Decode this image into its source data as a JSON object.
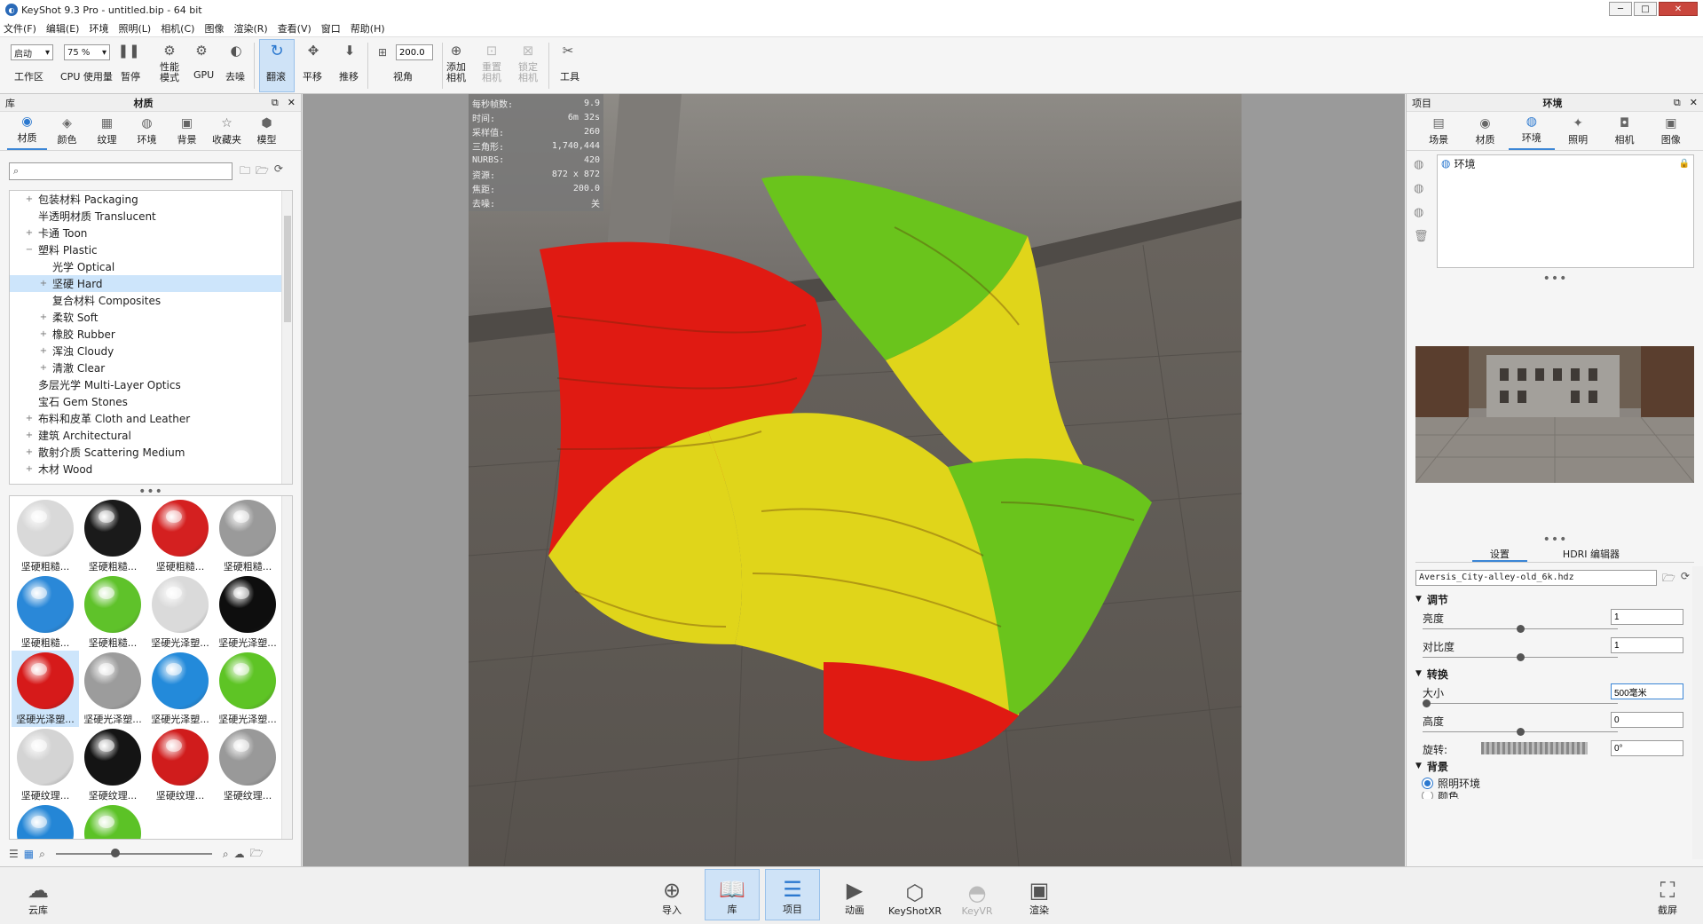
{
  "window": {
    "title": "KeyShot 9.3 Pro  - untitled.bip  - 64 bit",
    "minimize": "─",
    "maximize": "□",
    "close": "✕"
  },
  "menu": [
    "文件(F)",
    "编辑(E)",
    "环境",
    "照明(L)",
    "相机(C)",
    "图像",
    "渲染(R)",
    "查看(V)",
    "窗口",
    "帮助(H)"
  ],
  "toolbar": {
    "workspace_select": "启动",
    "workspace_label": "工作区",
    "cpu_select": "75 %",
    "cpu_label": "CPU 使用量",
    "pause_label": "暂停",
    "perf_label_1": "性能",
    "perf_label_2": "模式",
    "gpu_label": "GPU",
    "denoise_label": "去噪",
    "tumble_label": "翻滚",
    "pan_label": "平移",
    "dolly_label": "推移",
    "fov_value": "200.0",
    "fov_label": "视角",
    "add_camera_1": "添加",
    "add_camera_2": "相机",
    "reset_camera_1": "重置",
    "reset_camera_2": "相机",
    "lock_camera_1": "锁定",
    "lock_camera_2": "相机",
    "tools_label": "工具"
  },
  "library": {
    "header_left": "库",
    "header_title": "材质",
    "tabs": [
      {
        "label": "材质",
        "icon": "material-icon",
        "glyph": "◉"
      },
      {
        "label": "颜色",
        "icon": "color-icon",
        "glyph": "◈"
      },
      {
        "label": "纹理",
        "icon": "texture-icon",
        "glyph": "▦"
      },
      {
        "label": "环境",
        "icon": "environment-icon",
        "glyph": "◍"
      },
      {
        "label": "背景",
        "icon": "background-icon",
        "glyph": "▣"
      },
      {
        "label": "收藏夹",
        "icon": "favorites-icon",
        "glyph": "☆"
      },
      {
        "label": "模型",
        "icon": "model-icon",
        "glyph": "⬢"
      }
    ],
    "search_placeholder": "",
    "tree": [
      {
        "label": "包装材料 Packaging",
        "level": 1,
        "toggle": "+",
        "selected": false
      },
      {
        "label": "半透明材质 Translucent",
        "level": 1,
        "toggle": "",
        "selected": false
      },
      {
        "label": "卡通 Toon",
        "level": 1,
        "toggle": "+",
        "selected": false
      },
      {
        "label": "塑料 Plastic",
        "level": 1,
        "toggle": "−",
        "selected": false
      },
      {
        "label": "光学 Optical",
        "level": 2,
        "toggle": "",
        "selected": false
      },
      {
        "label": "坚硬 Hard",
        "level": 2,
        "toggle": "+",
        "selected": true
      },
      {
        "label": "复合材料 Composites",
        "level": 2,
        "toggle": "",
        "selected": false
      },
      {
        "label": "柔软 Soft",
        "level": 2,
        "toggle": "+",
        "selected": false
      },
      {
        "label": "橡胶 Rubber",
        "level": 2,
        "toggle": "+",
        "selected": false
      },
      {
        "label": "浑浊 Cloudy",
        "level": 2,
        "toggle": "+",
        "selected": false
      },
      {
        "label": "清澈 Clear",
        "level": 2,
        "toggle": "+",
        "selected": false
      },
      {
        "label": "多层光学 Multi-Layer Optics",
        "level": 1,
        "toggle": "",
        "selected": false
      },
      {
        "label": "宝石 Gem Stones",
        "level": 1,
        "toggle": "",
        "selected": false
      },
      {
        "label": "布料和皮革 Cloth and Leather",
        "level": 1,
        "toggle": "+",
        "selected": false
      },
      {
        "label": "建筑 Architectural",
        "level": 1,
        "toggle": "+",
        "selected": false
      },
      {
        "label": "散射介质 Scattering Medium",
        "level": 1,
        "toggle": "+",
        "selected": false
      },
      {
        "label": "木材 Wood",
        "level": 1,
        "toggle": "+",
        "selected": false
      }
    ],
    "thumbnails": [
      {
        "label": "坚硬粗糙...",
        "color": "#d9d9d9",
        "selected": false
      },
      {
        "label": "坚硬粗糙...",
        "color": "#1a1a1a",
        "selected": false
      },
      {
        "label": "坚硬粗糙...",
        "color": "#d42020",
        "selected": false
      },
      {
        "label": "坚硬粗糙...",
        "color": "#9a9a9a",
        "selected": false
      },
      {
        "label": "坚硬粗糙...",
        "color": "#2a88d8",
        "selected": false
      },
      {
        "label": "坚硬粗糙...",
        "color": "#5fc22a",
        "selected": false
      },
      {
        "label": "坚硬光泽塑...",
        "color": "#dadada",
        "selected": false
      },
      {
        "label": "坚硬光泽塑...",
        "color": "#0e0e0e",
        "selected": false
      },
      {
        "label": "坚硬光泽塑...",
        "color": "#d61a1a",
        "selected": true
      },
      {
        "label": "坚硬光泽塑...",
        "color": "#9c9c9c",
        "selected": false
      },
      {
        "label": "坚硬光泽塑...",
        "color": "#238ada",
        "selected": false
      },
      {
        "label": "坚硬光泽塑...",
        "color": "#5ec425",
        "selected": false
      },
      {
        "label": "坚硬纹理...",
        "color": "#d4d4d4",
        "selected": false
      },
      {
        "label": "坚硬纹理...",
        "color": "#141414",
        "selected": false
      },
      {
        "label": "坚硬纹理...",
        "color": "#d01c1c",
        "selected": false
      },
      {
        "label": "坚硬纹理...",
        "color": "#999999",
        "selected": false
      },
      {
        "label": "",
        "color": "#2486d6",
        "selected": false
      },
      {
        "label": "",
        "color": "#5cc226",
        "selected": false
      }
    ]
  },
  "stats": [
    {
      "label": "每秒帧数:",
      "value": "9.9"
    },
    {
      "label": "时间:",
      "value": "6m 32s"
    },
    {
      "label": "采样值:",
      "value": "260"
    },
    {
      "label": "三角形:",
      "value": "1,740,444"
    },
    {
      "label": "NURBS:",
      "value": "420"
    },
    {
      "label": "资源:",
      "value": "872 x 872"
    },
    {
      "label": "焦距:",
      "value": "200.0"
    },
    {
      "label": "去噪:",
      "value": "关"
    }
  ],
  "project": {
    "header_left": "项目",
    "header_title": "环境",
    "tabs": [
      {
        "label": "场景",
        "icon": "scene-icon",
        "glyph": "▤"
      },
      {
        "label": "材质",
        "icon": "material-icon",
        "glyph": "◉"
      },
      {
        "label": "环境",
        "icon": "environment-icon",
        "glyph": "◍"
      },
      {
        "label": "照明",
        "icon": "lighting-icon",
        "glyph": "✦"
      },
      {
        "label": "相机",
        "icon": "camera-icon",
        "glyph": "◘"
      },
      {
        "label": "图像",
        "icon": "image-icon",
        "glyph": "▣"
      }
    ],
    "env_list": [
      {
        "label": "环境"
      }
    ],
    "settings_tab": "设置",
    "hdri_editor_tab": "HDRI 编辑器",
    "hdri_file": "Aversis_City-alley-old_6k.hdz",
    "adjust_title": "调节",
    "brightness_label": "亮度",
    "brightness_value": "1",
    "brightness_slider": 0.5,
    "contrast_label": "对比度",
    "contrast_value": "1",
    "contrast_slider": 0.5,
    "transform_title": "转换",
    "size_label": "大小",
    "size_value": "500毫米",
    "size_slider": 0.0,
    "height_label": "高度",
    "height_value": "0",
    "height_slider": 0.5,
    "rotation_label": "旋转:",
    "rotation_value": "0°",
    "background_title": "背景",
    "bg_option_1": "照明环境",
    "bg_option_2": "颜色"
  },
  "bottom": {
    "cloud_label": "云库",
    "import_label": "导入",
    "library_label": "库",
    "project_label": "项目",
    "animation_label": "动画",
    "keyshotxr_label": "KeyShotXR",
    "keyvr_label": "KeyVR",
    "render_label": "渲染",
    "screenshot_label": "截屏"
  },
  "colors": {
    "accent": "#3b86d6",
    "active_bg": "#cfe3f7",
    "render_red": "#e01a12",
    "render_yellow": "#e0d51a",
    "render_green": "#6ac41c"
  }
}
